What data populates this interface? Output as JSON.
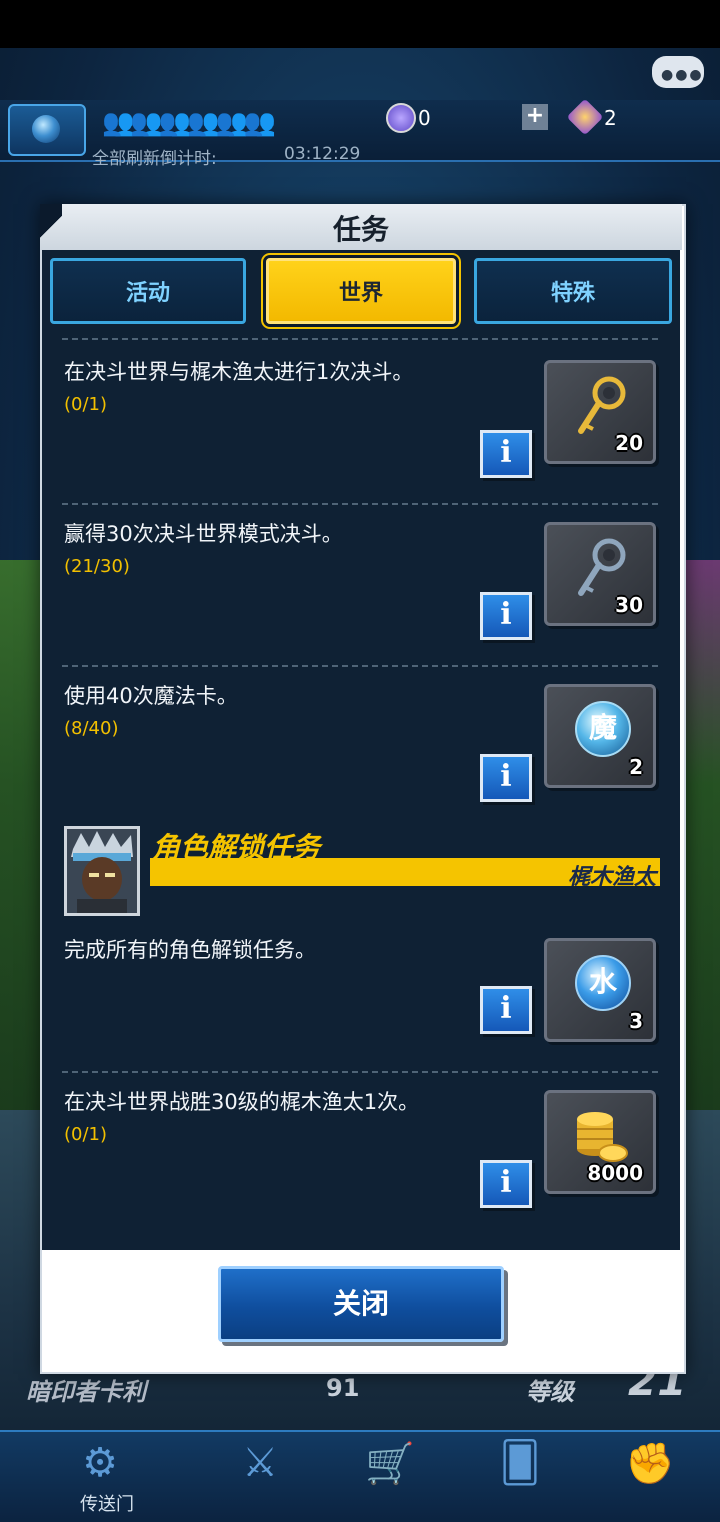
{
  "status_bar": {},
  "top_bar": {
    "gem_count": "0",
    "crystal_count": "2",
    "refresh_label": "全部刷新倒计时:",
    "refresh_time": "03:12:29"
  },
  "modal": {
    "title": "任务",
    "tabs": [
      {
        "label": "活动",
        "selected": false
      },
      {
        "label": "世界",
        "selected": true
      },
      {
        "label": "特殊",
        "selected": false
      }
    ],
    "missions": [
      {
        "title": "在决斗世界与梶木渔太进行1次决斗。",
        "progress": "(0/1)",
        "reward_icon": "gold-key-icon",
        "reward_count": "20"
      },
      {
        "title": "赢得30次决斗世界模式决斗。",
        "progress": "(21/30)",
        "reward_icon": "silver-key-icon",
        "reward_count": "30"
      },
      {
        "title": "使用40次魔法卡。",
        "progress": "(8/40)",
        "reward_icon": "magic-orb-icon",
        "reward_glyph": "魔",
        "reward_count": "2"
      }
    ],
    "character_unlock": {
      "heading": "角色解锁任务",
      "name": "梶木渔太",
      "missions": [
        {
          "title": "完成所有的角色解锁任务。",
          "progress": "",
          "reward_icon": "water-orb-icon",
          "reward_glyph": "水",
          "reward_count": "3"
        },
        {
          "title": "在决斗世界战胜30级的梶木渔太1次。",
          "progress": "(0/1)",
          "reward_icon": "gold-coins-icon",
          "reward_count": "8000"
        }
      ]
    },
    "close_label": "关闭"
  },
  "background": {
    "player_name": "暗印者卡利",
    "player_number": "91",
    "level_label": "等级",
    "level_value": "21",
    "nav_portal_label": "传送门"
  },
  "colors": {
    "accent_yellow": "#f5c400",
    "progress_yellow": "#f2c000",
    "panel_bg": "#0f2134",
    "tab_border": "#3aa7e0",
    "button_blue": "#1558b8"
  }
}
